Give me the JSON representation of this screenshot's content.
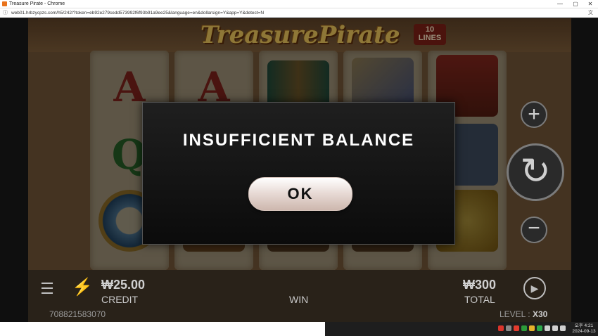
{
  "window": {
    "title": "Treasure Pirate - Chrome",
    "url": "web01.hrbzycpzs.com/h5/242/?token=eb92e279cedd573992f6f93b91a9ee25&language=en&dollarsign=Y&app=Y&detect=N",
    "controls": {
      "minimize": "—",
      "maximize": "▢",
      "close": "✕"
    }
  },
  "game": {
    "logo_text": "TreasurePirate",
    "lines_badge": "10\nLINES",
    "reel_symbols": {
      "a": "A",
      "q": "Q"
    }
  },
  "controls": {
    "plus": "+",
    "spin": "↻",
    "minus": "−"
  },
  "bottom_bar": {
    "credit_value": "₩25.00",
    "credit_label": "CREDIT",
    "win_label": "WIN",
    "total_value": "₩300",
    "total_label": "TOTAL",
    "session_id": "708821583070",
    "level_label": "LEVEL :",
    "level_value": "X30"
  },
  "modal": {
    "message": "INSUFFICIENT BALANCE",
    "ok_label": "OK"
  },
  "taskbar": {
    "time": "오후 4:21",
    "date": "2024-09-13",
    "colors": [
      "#d9342b",
      "#888888",
      "#e23b2e",
      "#2c9b3a",
      "#e5b12a",
      "#2aa84a",
      "#d0d0d0",
      "#d0d0d0",
      "#d0d0d0"
    ]
  },
  "icons": {
    "menu": "☰",
    "bolt": "⚡",
    "play": "▶",
    "translate": "文",
    "info": "ⓘ",
    "rewind": "↻"
  }
}
